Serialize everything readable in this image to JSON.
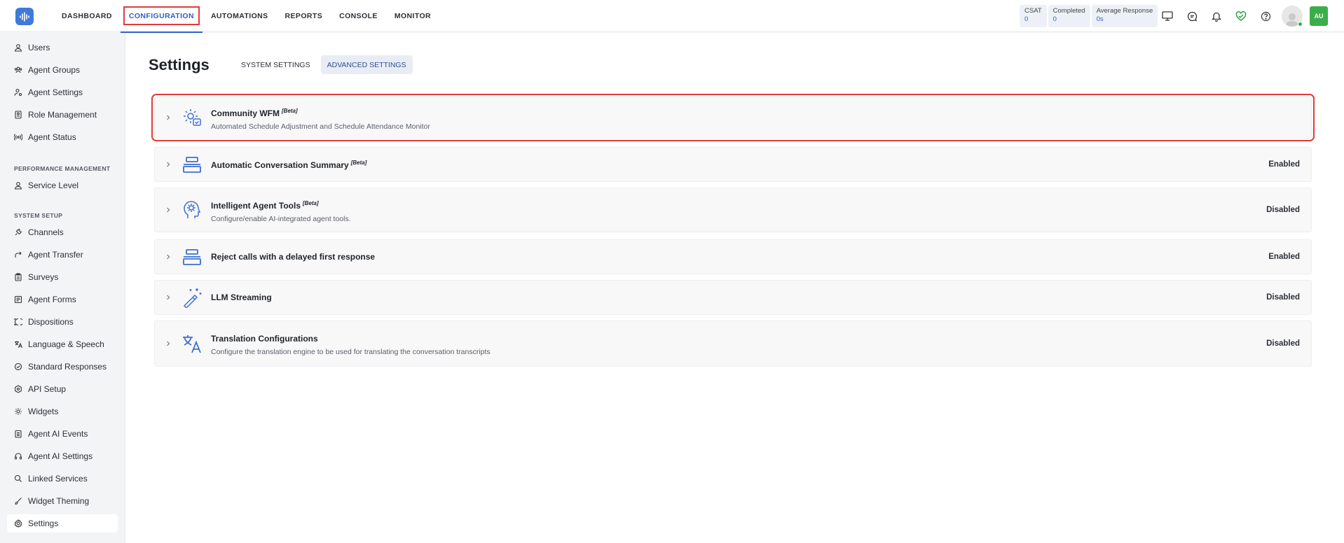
{
  "nav": {
    "items": [
      {
        "label": "DASHBOARD"
      },
      {
        "label": "CONFIGURATION"
      },
      {
        "label": "AUTOMATIONS"
      },
      {
        "label": "REPORTS"
      },
      {
        "label": "CONSOLE"
      },
      {
        "label": "MONITOR"
      }
    ],
    "active_index": 1
  },
  "stats": [
    {
      "label": "CSAT",
      "value": "0"
    },
    {
      "label": "Completed",
      "value": "0"
    },
    {
      "label": "Average Response",
      "value": "0s"
    }
  ],
  "top_icons": [
    "monitor-icon",
    "chat-icon",
    "bell-icon",
    "heart-check-icon",
    "help-icon"
  ],
  "user": {
    "initials": "AU",
    "status_color": "#2fb34a"
  },
  "sidebar": {
    "items_top": [
      {
        "label": "Users",
        "icon": "user-icon"
      },
      {
        "label": "Agent Groups",
        "icon": "group-icon"
      },
      {
        "label": "Agent Settings",
        "icon": "user-gear-icon"
      },
      {
        "label": "Role Management",
        "icon": "id-card-icon"
      },
      {
        "label": "Agent Status",
        "icon": "broadcast-icon"
      }
    ],
    "section_performance": "PERFORMANCE MANAGEMENT",
    "items_performance": [
      {
        "label": "Service Level",
        "icon": "user-icon"
      }
    ],
    "section_system": "SYSTEM SETUP",
    "items_system": [
      {
        "label": "Channels",
        "icon": "plug-icon"
      },
      {
        "label": "Agent Transfer",
        "icon": "transfer-icon"
      },
      {
        "label": "Surveys",
        "icon": "clipboard-icon"
      },
      {
        "label": "Agent Forms",
        "icon": "form-icon"
      },
      {
        "label": "Dispositions",
        "icon": "dispositions-icon"
      },
      {
        "label": "Language & Speech",
        "icon": "translate-icon"
      },
      {
        "label": "Standard Responses",
        "icon": "check-circle-icon"
      },
      {
        "label": "API Setup",
        "icon": "api-icon"
      },
      {
        "label": "Widgets",
        "icon": "widget-gear-icon"
      },
      {
        "label": "Agent AI Events",
        "icon": "events-icon"
      },
      {
        "label": "Agent AI Settings",
        "icon": "headset-icon"
      },
      {
        "label": "Linked Services",
        "icon": "search-icon"
      },
      {
        "label": "Widget Theming",
        "icon": "brush-icon"
      },
      {
        "label": "Settings",
        "icon": "gear-icon"
      }
    ],
    "active_label": "Settings"
  },
  "page": {
    "title": "Settings",
    "tabs": [
      {
        "label": "SYSTEM SETTINGS"
      },
      {
        "label": "ADVANCED SETTINGS"
      }
    ],
    "active_tab": 1
  },
  "cards": [
    {
      "title": "Community WFM",
      "badge": "[Beta]",
      "desc": "Automated Schedule Adjustment and Schedule Attendance Monitor",
      "status": "",
      "icon": "wfm-gear-icon"
    },
    {
      "title": "Automatic Conversation Summary",
      "badge": "[Beta]",
      "desc": "",
      "status": "Enabled",
      "icon": "summary-icon"
    },
    {
      "title": "Intelligent Agent Tools",
      "badge": "[Beta]",
      "desc": "Configure/enable AI-integrated agent tools.",
      "status": "Disabled",
      "icon": "ai-head-icon"
    },
    {
      "title": "Reject calls with a delayed first response",
      "badge": "",
      "desc": "",
      "status": "Enabled",
      "icon": "summary-icon"
    },
    {
      "title": "LLM Streaming",
      "badge": "",
      "desc": "",
      "status": "Disabled",
      "icon": "magic-wand-icon"
    },
    {
      "title": "Translation Configurations",
      "badge": "",
      "desc": "Configure the translation engine to be used for translating the conversation transcripts",
      "status": "Disabled",
      "icon": "translate-icon"
    }
  ],
  "colors": {
    "accent": "#2f62c8",
    "highlight": "#e23b3b",
    "icon_blue": "#3f6fd0"
  }
}
